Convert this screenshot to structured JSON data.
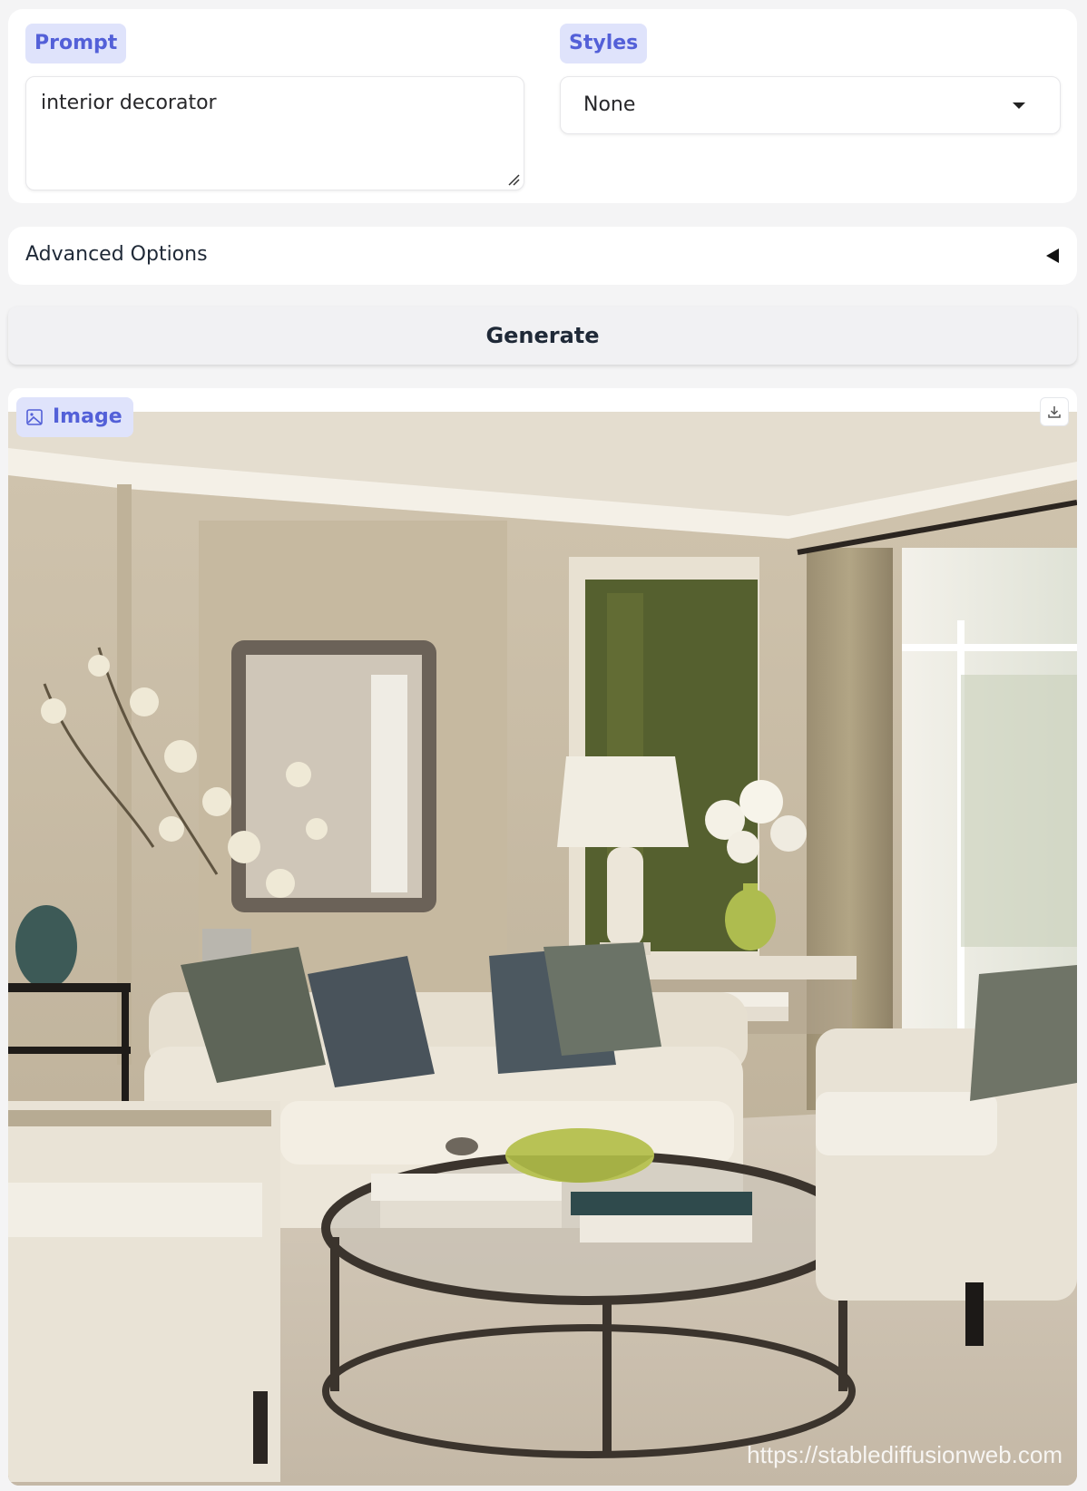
{
  "prompt": {
    "label": "Prompt",
    "value": "interior decorator"
  },
  "styles": {
    "label": "Styles",
    "selected": "None"
  },
  "advanced": {
    "label": "Advanced Options"
  },
  "generate": {
    "label": "Generate"
  },
  "image": {
    "label": "Image",
    "watermark": "https://stablediffusionweb.com"
  },
  "colors": {
    "accent": "#5360d8",
    "chip_bg": "#dfe3fb",
    "panel_bg": "#ffffff",
    "page_bg": "#f4f4f5"
  },
  "icons": {
    "image_label": "image-icon",
    "download": "download-icon",
    "dropdown": "caret-down-icon",
    "accordion": "caret-left-icon"
  }
}
